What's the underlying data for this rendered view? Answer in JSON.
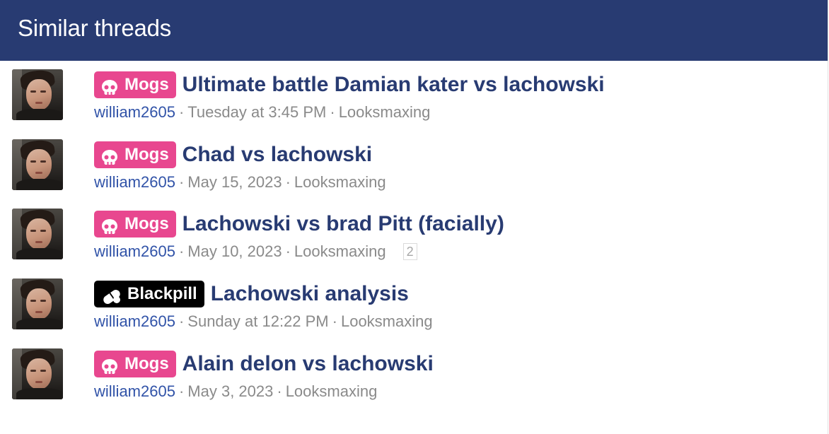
{
  "block": {
    "title": "Similar threads"
  },
  "colors": {
    "header_bg": "#283b72",
    "title_color": "#283b72",
    "username_color": "#3153a8",
    "mogs_label_bg": "#e8478f",
    "blackpill_label_bg": "#000000"
  },
  "threads": [
    {
      "label": "Mogs",
      "label_icon": "skull-icon",
      "title": "Ultimate battle Damian kater vs lachowski",
      "author": "william2605",
      "sep1": "·",
      "date": "Tuesday at 3:45 PM",
      "sep2": "·",
      "forum": "Looksmaxing",
      "pages": ""
    },
    {
      "label": "Mogs",
      "label_icon": "skull-icon",
      "title": "Chad vs lachowski",
      "author": "william2605",
      "sep1": "·",
      "date": "May 15, 2023",
      "sep2": "·",
      "forum": "Looksmaxing",
      "pages": ""
    },
    {
      "label": "Mogs",
      "label_icon": "skull-icon",
      "title": "Lachowski vs brad Pitt (facially)",
      "author": "william2605",
      "sep1": "·",
      "date": "May 10, 2023",
      "sep2": "·",
      "forum": "Looksmaxing",
      "pages": "2"
    },
    {
      "label": "Blackpill",
      "label_icon": "pill-icon",
      "title": "Lachowski analysis",
      "author": "william2605",
      "sep1": "·",
      "date": "Sunday at 12:22 PM",
      "sep2": "·",
      "forum": "Looksmaxing",
      "pages": ""
    },
    {
      "label": "Mogs",
      "label_icon": "skull-icon",
      "title": "Alain delon vs lachowski",
      "author": "william2605",
      "sep1": "·",
      "date": "May 3, 2023",
      "sep2": "·",
      "forum": "Looksmaxing",
      "pages": ""
    }
  ]
}
